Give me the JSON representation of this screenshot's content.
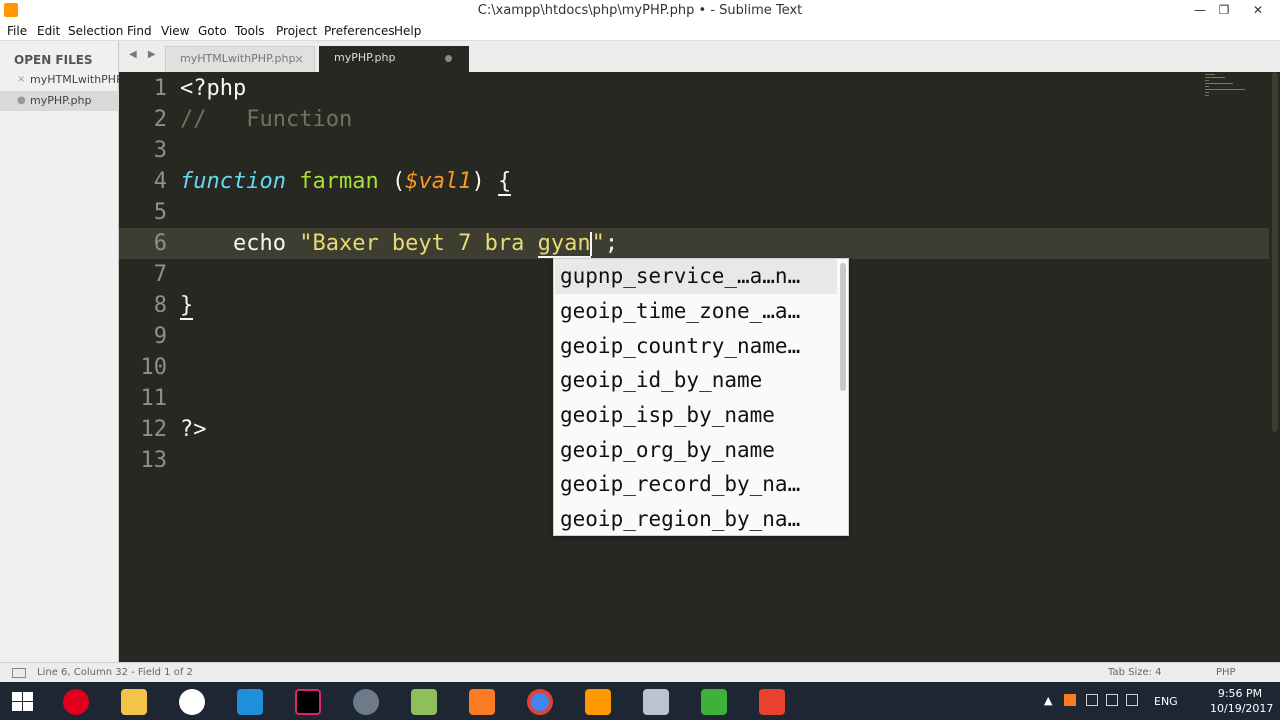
{
  "window": {
    "title": "C:\\xampp\\htdocs\\php\\myPHP.php • - Sublime Text",
    "minimize_glyph": "—",
    "maximize_glyph": "❐",
    "close_glyph": "✕"
  },
  "menu": [
    "File",
    "Edit",
    "Selection",
    "Find",
    "View",
    "Goto",
    "Tools",
    "Project",
    "Preferences",
    "Help"
  ],
  "sidebar": {
    "header": "OPEN FILES",
    "files": [
      {
        "name": "myHTMLwithPHP.php",
        "mark": "×",
        "active": false
      },
      {
        "name": "myPHP.php",
        "mark": "●",
        "active": true
      }
    ]
  },
  "tabs": {
    "arrows": "◀ ▶",
    "items": [
      {
        "label": "myHTMLwithPHP.php",
        "close": "×",
        "active": false
      },
      {
        "label": "myPHP.php",
        "active": true,
        "dirty": true
      }
    ]
  },
  "editor": {
    "line_numbers": [
      "1",
      "2",
      "3",
      "4",
      "5",
      "6",
      "7",
      "8",
      "9",
      "10",
      "11",
      "12",
      "13"
    ],
    "current_line": 6,
    "lines": {
      "l1": "<?php",
      "l2": "//   Function",
      "l4_kw": "function",
      "l4_fn": "farman",
      "l4_open": " (",
      "l4_param": "$val",
      "l4_close": ") ",
      "l4_brace": "{",
      "l6_echo": "echo",
      "l6_str_before": "\"Baxer beyt 7 bra ",
      "l6_str_word": "gyan",
      "l6_str_after": "\"",
      "l6_semi": ";",
      "l8": "}",
      "l12": "?>"
    }
  },
  "autocomplete": {
    "items": [
      "gupnp_service_…a…n…",
      "geoip_time_zone_…a…",
      "geoip_country_name…",
      "geoip_id_by_name",
      "geoip_isp_by_name",
      "geoip_org_by_name",
      "geoip_record_by_na…",
      "geoip_region_by_na…"
    ],
    "selected_index": 0
  },
  "statusbar": {
    "position": "Line 6, Column 32 - Field 1 of 2",
    "tab_size": "Tab Size: 4",
    "syntax": "PHP"
  },
  "taskbar": {
    "tray_lang": "ENG",
    "time": "9:56 PM",
    "date": "10/19/2017",
    "apps": [
      "opera-icon",
      "file-explorer-icon",
      "github-icon",
      "outlook-icon",
      "intellij-icon",
      "paint-icon",
      "notepadpp-icon",
      "xampp-icon",
      "chrome-icon",
      "sublime-icon",
      "calculator-icon",
      "camtasia-icon",
      "camtasia-recorder-icon"
    ],
    "colors": {
      "opera": "#e0001b",
      "explorer": "#f3c34a",
      "github": "#ffffff",
      "outlook": "#1e8fd8",
      "intellij": "#e0236a",
      "xampp": "#fb7a24",
      "chrome": "#4285f4",
      "sublime": "#ff9800",
      "camtasia": "#3fb13a",
      "recorder": "#e8412e"
    }
  }
}
